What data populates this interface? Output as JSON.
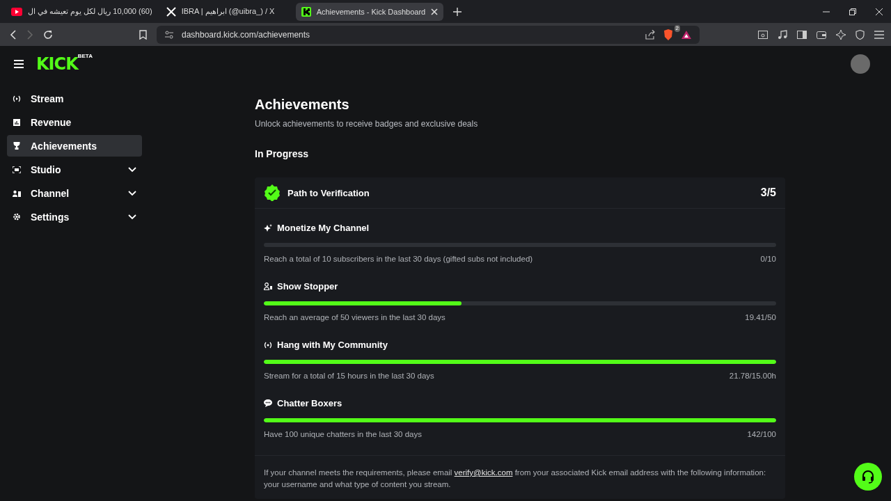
{
  "browser": {
    "tabs": [
      {
        "kind": "youtube",
        "title": "(60) 10,000 ريال لكل يوم تعيشه في ال",
        "selected": false
      },
      {
        "kind": "x",
        "title": "IBRA | ابراهيم (@uibra_) / X",
        "selected": false
      },
      {
        "kind": "kick",
        "title": "Achievements - Kick Dashboard",
        "selected": true
      }
    ],
    "url": "dashboard.kick.com/achievements",
    "shield_count": "2"
  },
  "header": {
    "logo": "KICK",
    "logo_badge": "BETA"
  },
  "sidebar": {
    "items": [
      {
        "label": "Stream",
        "selected": false,
        "expandable": false
      },
      {
        "label": "Revenue",
        "selected": false,
        "expandable": false
      },
      {
        "label": "Achievements",
        "selected": true,
        "expandable": false
      },
      {
        "label": "Studio",
        "selected": false,
        "expandable": true
      },
      {
        "label": "Channel",
        "selected": false,
        "expandable": true
      },
      {
        "label": "Settings",
        "selected": false,
        "expandable": true
      }
    ]
  },
  "page": {
    "title": "Achievements",
    "subtitle": "Unlock achievements to receive badges and exclusive deals",
    "section": "In Progress"
  },
  "card": {
    "title": "Path to Verification",
    "progress": "3/5",
    "tasks": [
      {
        "title": "Monetize My Channel",
        "description": "Reach a total of 10 subscribers in the last 30 days (gifted subs not included)",
        "value": "0/10",
        "level": 0
      },
      {
        "title": "Show Stopper",
        "description": "Reach an average of 50 viewers in the last 30 days",
        "value": "19.41/50",
        "level": 0.386
      },
      {
        "title": "Hang with My Community",
        "description": "Stream for a total of 15 hours in the last 30 days",
        "value": "21.78/15.00h",
        "level": 1
      },
      {
        "title": "Chatter Boxers",
        "description": "Have 100 unique chatters in the last 30 days",
        "value": "142/100",
        "level": 1
      }
    ],
    "note_before": "If your channel meets the requirements, please email ",
    "note_link": "verify@kick.com",
    "note_after": " from your associated Kick email address with the following information: your username and what type of content you stream."
  }
}
